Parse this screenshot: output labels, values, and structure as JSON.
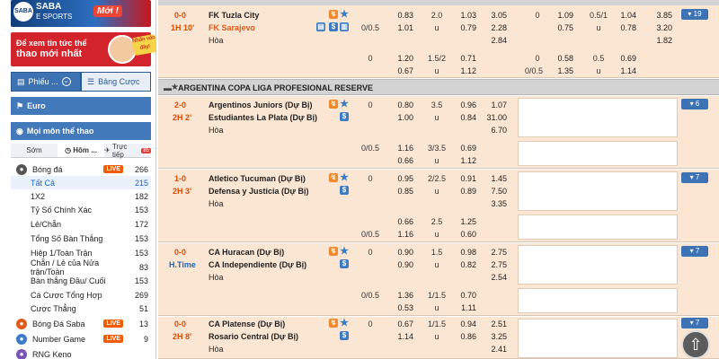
{
  "sidebar": {
    "banner1": {
      "logo": "SABA",
      "title": "SABA",
      "subtitle": "E SPORTS",
      "badge": "Mới !"
    },
    "banner2": {
      "line1": "Để xem tin tức thể",
      "line2": "thao mới nhất",
      "stamp": "Nhấn vào đây!"
    },
    "tabs": [
      {
        "label": "Phiếu ..."
      },
      {
        "label": "Bảng Cược"
      }
    ],
    "euro": "Euro",
    "all_sports": "Mọi môn thể thao",
    "subtabs": [
      {
        "label": "Sớm"
      },
      {
        "label": "Hôm ..."
      },
      {
        "label": "Trực tiếp",
        "badge": "85"
      }
    ],
    "sports": [
      {
        "name": "Bóng đá",
        "live": "LIVE",
        "count": "266"
      },
      {
        "name": "Bóng Đá Saba",
        "live": "LIVE",
        "count": "13"
      },
      {
        "name": "Number Game",
        "live": "LIVE",
        "count": "9"
      },
      {
        "name": "RNG Keno",
        "live": "",
        "count": ""
      }
    ],
    "subitems": [
      {
        "name": "Tất Cả",
        "count": "215"
      },
      {
        "name": "1X2",
        "count": "182"
      },
      {
        "name": "Tỷ Số Chính Xác",
        "count": "153"
      },
      {
        "name": "Lẻ/Chẵn",
        "count": "172"
      },
      {
        "name": "Tổng Số Bàn Thắng",
        "count": "153"
      },
      {
        "name": "Hiệp 1/Toàn Trận",
        "count": "153"
      },
      {
        "name": "Chẵn / Lẻ của Nửa trận/Toàn",
        "count": "83"
      },
      {
        "name": "Bàn thắng Đầu/ Cuối",
        "count": "153"
      },
      {
        "name": "Cá Cược Tổng Hợp",
        "count": "269"
      },
      {
        "name": "Cược Thẳng",
        "count": "51"
      }
    ]
  },
  "main": {
    "league2": "ARGENTINA COPA LIGA PROFESIONAL RESERVE",
    "draw": "Hòa",
    "matches": [
      {
        "score": "0-0",
        "time": "1H 10'",
        "home": "FK Tuzla City",
        "away": "FK Sarajevo",
        "more": "19",
        "r1": [
          "",
          "0.83",
          "2.0",
          "1.03",
          "3.05",
          "0",
          "1.09",
          "0.5/1",
          "1.04",
          "3.85"
        ],
        "r2": [
          "0/0.5",
          "1.01",
          "u",
          "0.79",
          "2.28",
          "",
          "0.75",
          "u",
          "0.78",
          "3.20"
        ],
        "r3": [
          "",
          "",
          "",
          "",
          "2.84",
          "",
          "",
          "",
          "",
          "1.82"
        ],
        "r4": [
          "0",
          "1.20",
          "1.5/2",
          "0.71",
          "",
          "0",
          "0.58",
          "0.5",
          "0.69",
          ""
        ],
        "r5": [
          "",
          "0.67",
          "u",
          "1.12",
          "",
          "0/0.5",
          "1.35",
          "u",
          "1.14",
          ""
        ]
      },
      {
        "score": "2-0",
        "time": "2H 2'",
        "home": "Argentinos Juniors (Dự Bị)",
        "away": "Estudiantes La Plata (Dự Bị)",
        "more": "6",
        "r1": [
          "0",
          "0.80",
          "3.5",
          "0.96",
          "1.07"
        ],
        "r2": [
          "",
          "1.00",
          "u",
          "0.84",
          "31.00"
        ],
        "r3": [
          "",
          "",
          "",
          "",
          "6.70"
        ],
        "r4": [
          "0/0.5",
          "1.16",
          "3/3.5",
          "0.69",
          ""
        ],
        "r5": [
          "",
          "0.66",
          "u",
          "1.12",
          ""
        ]
      },
      {
        "score": "1-0",
        "time": "2H 3'",
        "home": "Atletico Tucuman (Dự Bị)",
        "away": "Defensa y Justicia (Dự Bị)",
        "more": "7",
        "r1": [
          "0",
          "0.95",
          "2/2.5",
          "0.91",
          "1.45"
        ],
        "r2": [
          "",
          "0.85",
          "u",
          "0.89",
          "7.50"
        ],
        "r3": [
          "",
          "",
          "",
          "",
          "3.35"
        ],
        "r4": [
          "",
          "0.66",
          "2.5",
          "1.25",
          ""
        ],
        "r5": [
          "0/0.5",
          "1.16",
          "u",
          "0.60",
          ""
        ]
      },
      {
        "score": "0-0",
        "time": "H.Time",
        "home": "CA Huracan (Dự Bị)",
        "away": "CA Independiente (Dự Bị)",
        "more": "7",
        "r1": [
          "0",
          "0.90",
          "1.5",
          "0.98",
          "2.75"
        ],
        "r2": [
          "",
          "0.90",
          "u",
          "0.82",
          "2.75"
        ],
        "r3": [
          "",
          "",
          "",
          "",
          "2.54"
        ],
        "r4": [
          "0/0.5",
          "1.36",
          "1/1.5",
          "0.70",
          ""
        ],
        "r5": [
          "",
          "0.53",
          "u",
          "1.11",
          ""
        ]
      },
      {
        "score": "0-0",
        "time": "2H 8'",
        "home": "CA Platense (Dự Bị)",
        "away": "Rosario Central (Dự Bị)",
        "more": "7",
        "r1": [
          "0",
          "0.67",
          "1/1.5",
          "0.94",
          "2.51"
        ],
        "r2": [
          "",
          "1.14",
          "u",
          "0.86",
          "3.25"
        ],
        "r3": [
          "",
          "",
          "",
          "",
          "2.41"
        ],
        "r4": [
          "",
          "",
          "",
          "",
          ""
        ],
        "r5": [
          "",
          "",
          "",
          "",
          ""
        ]
      }
    ]
  }
}
